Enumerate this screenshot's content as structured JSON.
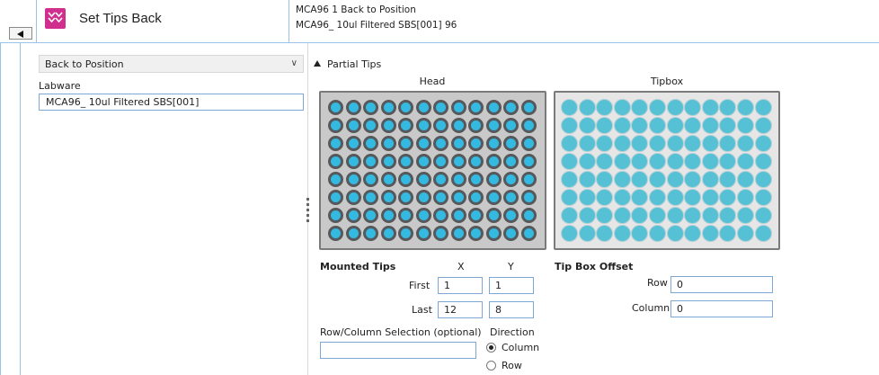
{
  "header": {
    "step_title": "Set Tips Back",
    "summary_line1": "MCA96 1 Back to Position",
    "summary_line2": "MCA96_ 10ul Filtered SBS[001] 96",
    "step_icon": "double-chevron-down-icon",
    "collapse_icon": "triangle-left-icon"
  },
  "left": {
    "mode_select": "Back to Position",
    "labware_label": "Labware",
    "labware_value": "MCA96_ 10ul Filtered SBS[001]"
  },
  "right": {
    "partial_tips_label": "Partial Tips",
    "head_label": "Head",
    "tipbox_label": "Tipbox",
    "plate_rows": 8,
    "plate_cols": 12,
    "mounted_tips_label": "Mounted Tips",
    "x_label": "X",
    "y_label": "Y",
    "first_label": "First",
    "last_label": "Last",
    "first_x": "1",
    "first_y": "1",
    "last_x": "12",
    "last_y": "8",
    "tip_box_offset_label": "Tip Box Offset",
    "row_label": "Row",
    "column_label": "Column",
    "row_offset": "0",
    "column_offset": "0",
    "rowcol_selection_label": "Row/Column Selection (optional)",
    "rowcol_selection_value": "",
    "direction_label": "Direction",
    "direction_column": "Column",
    "direction_row": "Row",
    "direction_selected": "Column"
  },
  "colors": {
    "accent_pink": "#d12f8d",
    "tip_blue": "#34b9e0",
    "border_blue": "#9cc3e6"
  }
}
